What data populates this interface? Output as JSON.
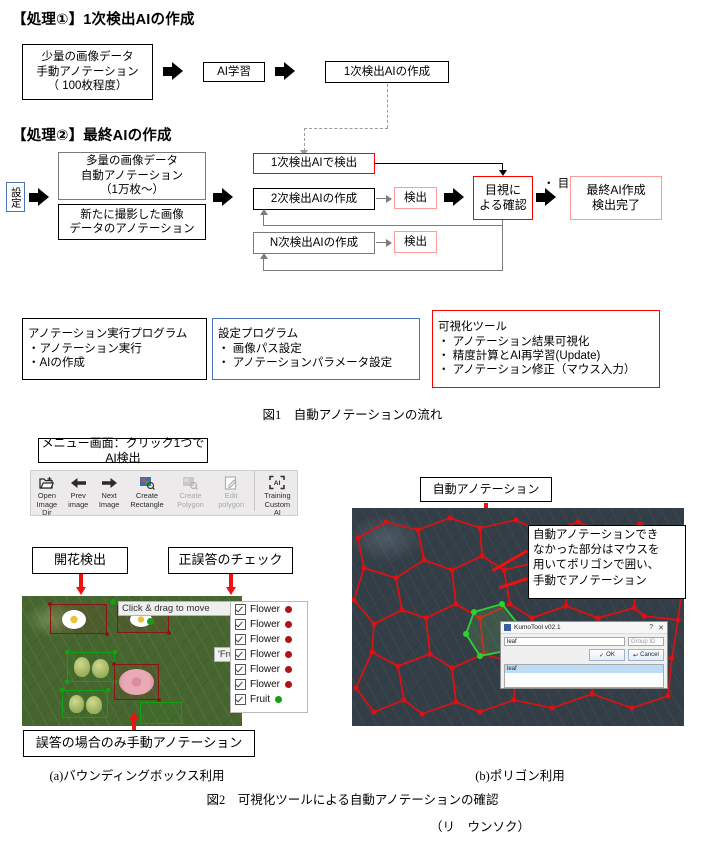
{
  "section1": {
    "heading": "【処理①】1次検出AIの作成",
    "box_input": "少量の画像データ\n手動アノテーション\n（ 100枚程度）",
    "box_input_l1": "少量の画像データ",
    "box_input_l2": "手動アノテーション",
    "box_input_l3": "（ 100枚程度）",
    "box_learn": "AI学習",
    "box_make": "1次検出AIの作成"
  },
  "section2": {
    "heading": "【処理②】最終AIの作成",
    "box_setting": "設定",
    "box_mass_l1": "多量の画像データ",
    "box_mass_l2": "自動アノテーション",
    "box_mass_l3": "（1万枚～）",
    "box_new_l1": "新たに撮影した画像",
    "box_new_l2": "データのアノテーション",
    "box_detect_primary": "1次検出AIで検出",
    "box_make_2nd": "2次検出AIの作成",
    "box_detect_2nd": "検出",
    "box_make_n": "N次検出AIの作成",
    "box_detect_n": "検出",
    "box_visual_l1": "目視に",
    "box_visual_l2": "よる確認",
    "note_goal": "・ 目標精度達成の場合",
    "box_final_l1": "最終AI作成",
    "box_final_l2": "検出完了"
  },
  "programs": [
    {
      "title": "アノテーション実行プログラム",
      "items": [
        "・アノテーション実行",
        "・AIの作成"
      ],
      "border": "#000000"
    },
    {
      "title": "設定プログラム",
      "items": [
        "・ 画像パス設定",
        "・ アノテーションパラメータ設定"
      ],
      "border": "#4a72b8"
    },
    {
      "title": "可視化ツール",
      "items": [
        "・ アノテーション結果可視化",
        "・ 精度計算とAI再学習(Update)",
        "・ アノテーション修正（マウス入力）"
      ],
      "border": "#ff0000"
    }
  ],
  "fig1_caption": "図1　自動アノテーションの流れ",
  "fig2": {
    "menu_label": "メニュー画面：クリック1つでAI検出",
    "toolbar": [
      {
        "label_lines": [
          "Open",
          "Image",
          "Dir"
        ],
        "icon": "open-folder-icon",
        "dim": false
      },
      {
        "label_lines": [
          "Prev",
          "image"
        ],
        "icon": "arrow-left-icon",
        "dim": false
      },
      {
        "label_lines": [
          "Next",
          "Image"
        ],
        "icon": "arrow-right-icon",
        "dim": false
      },
      {
        "label_lines": [
          "Create",
          "Rectangle"
        ],
        "icon": "create-rectangle-icon",
        "dim": false
      },
      {
        "label_lines": [
          "Create",
          "Polygon"
        ],
        "icon": "create-polygon-icon",
        "dim": true
      },
      {
        "label_lines": [
          "Edit",
          "polygon"
        ],
        "icon": "edit-polygon-icon",
        "dim": true
      },
      {
        "label_lines": [
          "Training",
          "Custom",
          "AI"
        ],
        "icon": "training-ai-icon",
        "dim": false
      }
    ],
    "label_bloom": "開花検出",
    "label_check": "正誤答のチェック",
    "tooltip_drag": "Click & drag to move",
    "tooltip_fruit": "'Fruit'",
    "list_items": [
      {
        "label": "Flower",
        "checked": true,
        "dot": "red"
      },
      {
        "label": "Flower",
        "checked": true,
        "dot": "red"
      },
      {
        "label": "Flower",
        "checked": true,
        "dot": "red"
      },
      {
        "label": "Flower",
        "checked": true,
        "dot": "red"
      },
      {
        "label": "Flower",
        "checked": true,
        "dot": "red"
      },
      {
        "label": "Flower",
        "checked": true,
        "dot": "red"
      },
      {
        "label": "Fruit",
        "checked": true,
        "dot": "green"
      }
    ],
    "label_manual": "誤答の場合のみ手動アノテーション",
    "caption_a": "(a)バウンディングボックス利用",
    "label_auto_anno": "自動アノテーション",
    "callout_lines": [
      "自動アノテーションでき",
      "なかった部分はマウスを",
      "用いてポリゴンで囲い、",
      "手動でアノテーション"
    ],
    "dialog": {
      "title": "KumoTool v02.1",
      "help_btn": "?",
      "close_btn": "✕",
      "input_value": "leaf",
      "group_placeholder": "Group ID",
      "ok": "OK",
      "cancel": "Cancel",
      "list_selected": "leaf"
    },
    "caption_b": "(b)ポリゴン利用"
  },
  "fig2_caption": "図2　可視化ツールによる自動アノテーションの確認",
  "author": "（リ　ウンソク）"
}
